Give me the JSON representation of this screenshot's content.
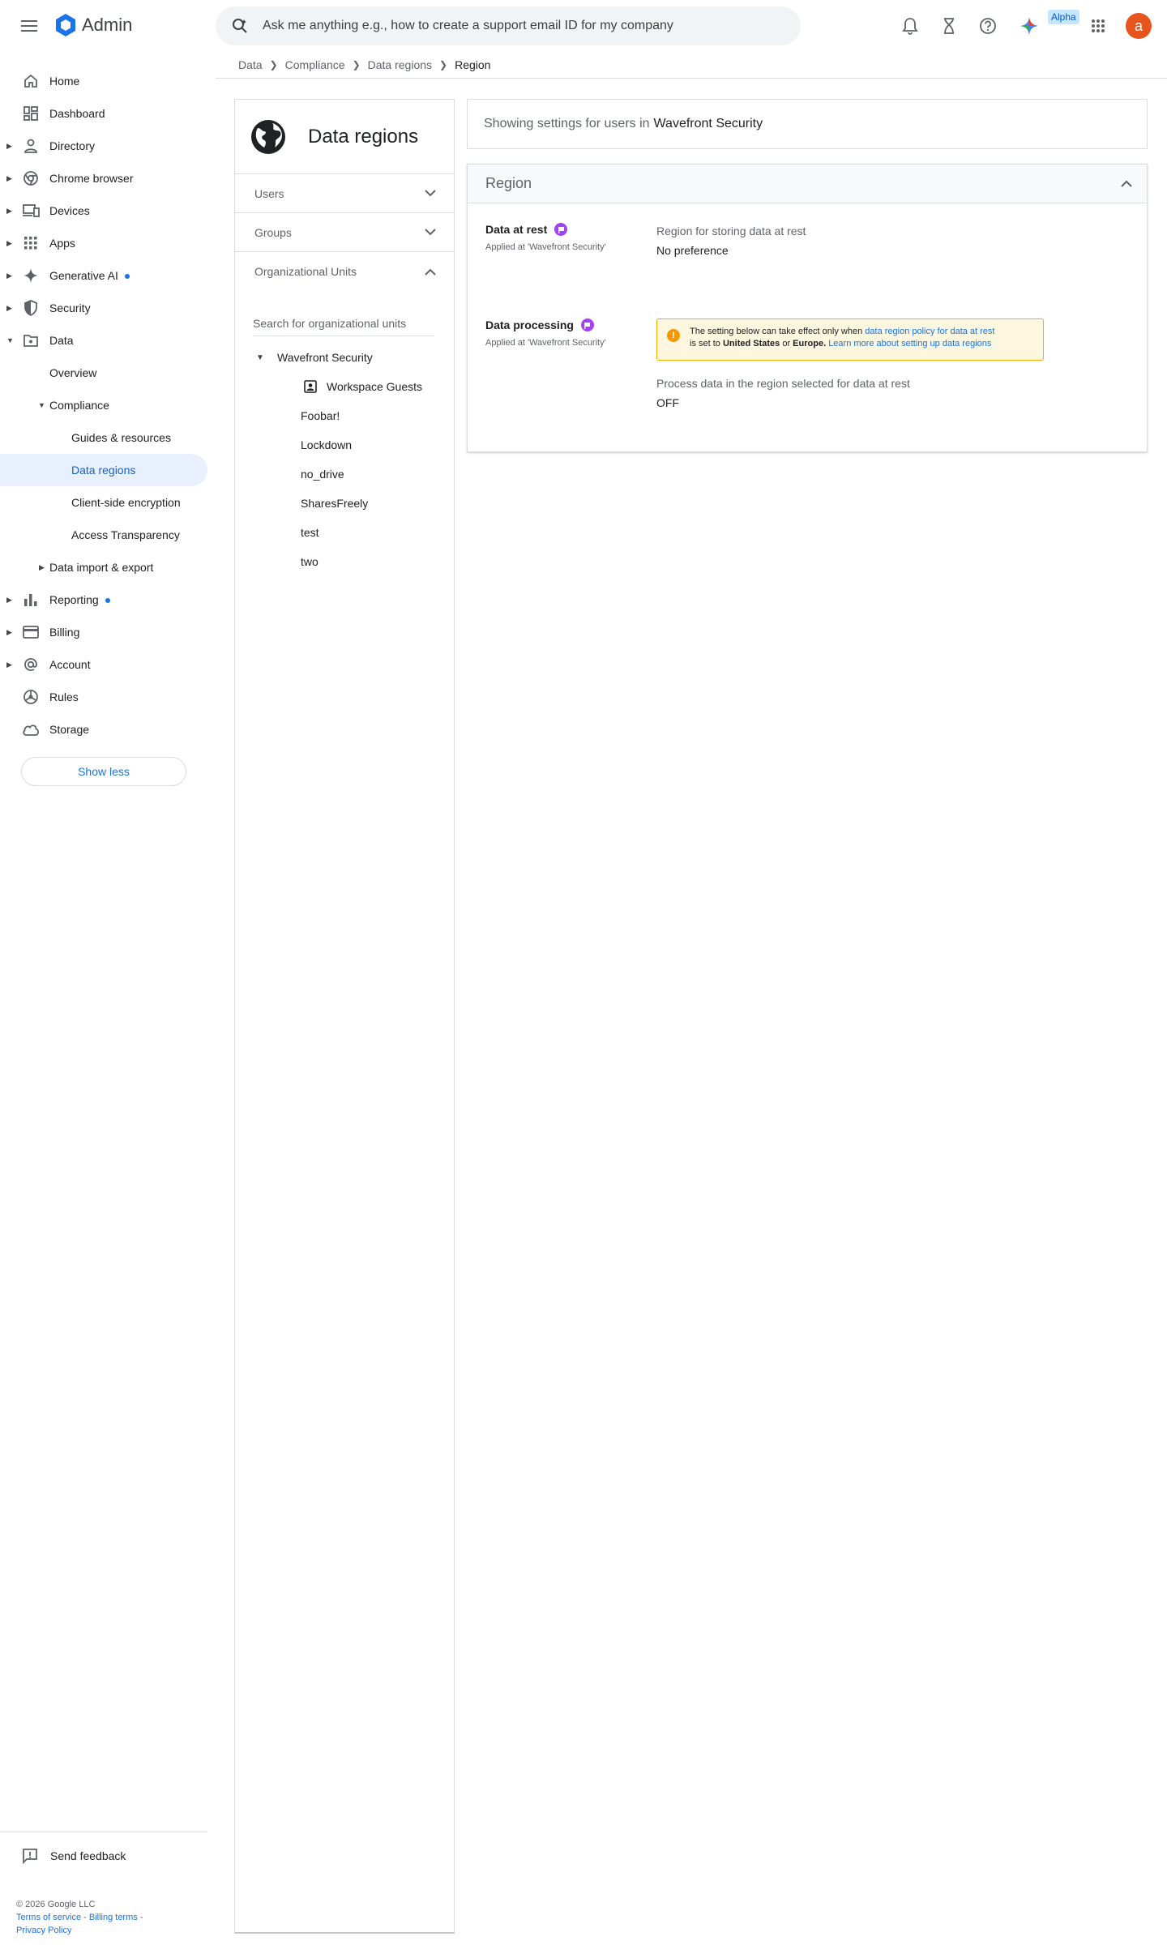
{
  "header": {
    "brand": "Admin",
    "search_placeholder": "Ask me anything e.g., how to create a support email ID for my company",
    "alpha_badge": "Alpha",
    "avatar_letter": "a"
  },
  "breadcrumb": [
    "Data",
    "Compliance",
    "Data regions",
    "Region"
  ],
  "nav": {
    "items": [
      {
        "label": "Home",
        "icon": "home-icon"
      },
      {
        "label": "Dashboard",
        "icon": "dashboard-icon"
      },
      {
        "label": "Directory",
        "icon": "person-icon"
      },
      {
        "label": "Chrome browser",
        "icon": "chrome-icon"
      },
      {
        "label": "Devices",
        "icon": "devices-icon"
      },
      {
        "label": "Apps",
        "icon": "apps-grid-icon"
      },
      {
        "label": "Generative AI",
        "icon": "sparkle-icon"
      },
      {
        "label": "Security",
        "icon": "shield-icon"
      },
      {
        "label": "Data",
        "icon": "folder-icon"
      },
      {
        "label": "Overview"
      },
      {
        "label": "Compliance"
      },
      {
        "label": "Guides & resources"
      },
      {
        "label": "Data regions"
      },
      {
        "label": "Client-side encryption"
      },
      {
        "label": "Access Transparency"
      },
      {
        "label": "Data import & export"
      },
      {
        "label": "Reporting",
        "icon": "bar-chart-icon"
      },
      {
        "label": "Billing",
        "icon": "credit-card-icon"
      },
      {
        "label": "Account",
        "icon": "at-sign-icon"
      },
      {
        "label": "Rules",
        "icon": "rules-icon"
      },
      {
        "label": "Storage",
        "icon": "cloud-icon"
      }
    ],
    "show_less": "Show less",
    "send_feedback": "Send feedback"
  },
  "footer": {
    "copyright": "© 2026 Google LLC",
    "terms": "Terms of service",
    "billing_terms": "Billing terms",
    "privacy": "Privacy Policy",
    "separator": " - "
  },
  "panel": {
    "title": "Data regions",
    "sections": [
      "Users",
      "Groups",
      "Organizational Units"
    ],
    "ou_search_placeholder": "Search for organizational units",
    "root_ou": "Wavefront Security",
    "child_ous": [
      "Workspace Guests",
      "Foobar!",
      "Lockdown",
      "no_drive",
      "SharesFreely",
      "test",
      "two"
    ]
  },
  "main": {
    "banner_prefix": "Showing settings for users in",
    "banner_org": "Wavefront Security",
    "card_title": "Region",
    "data_at_rest": {
      "name": "Data at rest",
      "applied": "Applied at 'Wavefront Security'",
      "label": "Region for storing data at rest",
      "value": "No preference"
    },
    "data_processing": {
      "name": "Data processing",
      "applied": "Applied at 'Wavefront Security'",
      "warning_text_1": "The setting below can take effect only when",
      "warning_link_1": "data region policy for data at rest",
      "warning_text_2": "is set to",
      "warning_bold_1": "United States",
      "warning_text_3": "or",
      "warning_bold_2": "Europe.",
      "warning_link_2": "Learn more about setting up data regions",
      "label": "Process data in the region selected for data at rest",
      "value": "OFF"
    }
  },
  "colors": {
    "accent": "#1a73e8",
    "active_bg": "#e8f0fe",
    "avatar": "#e8541e",
    "flag": "#a142f4",
    "warning_bg": "#fef7e0",
    "warning_border": "#f9ab00"
  }
}
